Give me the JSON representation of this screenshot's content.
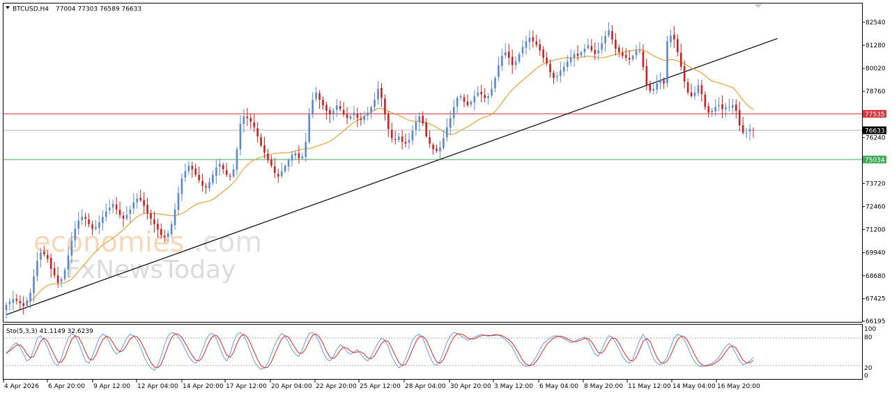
{
  "header": {
    "symbol": "BTCUSD,H4",
    "ohlc": "77004 77303 76589 76633"
  },
  "indicator": {
    "label": "Sto(5,3,3) 41.1149 32.6239",
    "levels": [
      "100",
      "80",
      "20",
      "0"
    ]
  },
  "watermark": {
    "line1_a": "economies",
    "line1_b": ".com",
    "line2": "FxNewsToday"
  },
  "price_labels": {
    "current": "76633",
    "resistance": "77535",
    "support": "75034"
  },
  "colors": {
    "bull": "#5b87d1",
    "bear": "#cc1f1f",
    "ma": "#e4a23c",
    "resistance": "#d9333f",
    "support": "#3fa95b",
    "stoch_main": "#6b9bd8",
    "stoch_signal": "#cc2a2a",
    "current_label_bg": "#000000"
  },
  "chart_data": {
    "type": "candlestick",
    "y_ticks": [
      "82540",
      "81280",
      "80020",
      "78760",
      "77500",
      "76240",
      "74980",
      "73720",
      "72460",
      "71200",
      "69940",
      "68680",
      "67425",
      "66195"
    ],
    "x_ticks": [
      "4 Apr 2026",
      "6 Apr 20:00",
      "9 Apr 12:00",
      "12 Apr 04:00",
      "14 Apr 20:00",
      "17 Apr 12:00",
      "20 Apr 04:00",
      "22 Apr 20:00",
      "25 Apr 12:00",
      "28 Apr 04:00",
      "30 Apr 20:00",
      "3 May 12:00",
      "6 May 04:00",
      "8 May 20:00",
      "11 May 12:00",
      "14 May 04:00",
      "16 May 20:00"
    ],
    "ylim": [
      66195,
      83600
    ],
    "resistance": 77535,
    "support": 75034,
    "current": 76633,
    "trendline": [
      [
        0,
        66550
      ],
      [
        224,
        81650
      ]
    ],
    "closes": [
      67080,
      67250,
      67400,
      67310,
      67180,
      67030,
      67320,
      67750,
      68650,
      69500,
      69950,
      69850,
      69600,
      69050,
      68700,
      68300,
      68500,
      69000,
      69800,
      70600,
      71250,
      71700,
      71900,
      71800,
      71500,
      71250,
      71350,
      71600,
      71900,
      72200,
      72400,
      72600,
      72300,
      72000,
      71800,
      72000,
      72300,
      72700,
      72900,
      72800,
      72500,
      72100,
      71800,
      71500,
      71200,
      70900,
      70800,
      71000,
      71500,
      72300,
      73200,
      74000,
      74400,
      74700,
      74500,
      74200,
      73900,
      73600,
      73500,
      73800,
      74200,
      74600,
      74800,
      74500,
      74200,
      74100,
      74500,
      75600,
      77000,
      77400,
      77300,
      77100,
      76800,
      76300,
      75800,
      75400,
      75000,
      74700,
      74300,
      74100,
      74400,
      74700,
      75000,
      75300,
      75400,
      75100,
      75200,
      76000,
      77500,
      78300,
      78700,
      78300,
      78000,
      77700,
      77500,
      77700,
      78000,
      77800,
      77500,
      77300,
      77400,
      77600,
      77300,
      77200,
      77400,
      77600,
      77900,
      78300,
      78900,
      78400,
      77500,
      76700,
      76200,
      76100,
      76300,
      76000,
      75900,
      76100,
      76600,
      77100,
      77400,
      77000,
      76300,
      75900,
      75600,
      75500,
      75700,
      76200,
      76800,
      77300,
      77900,
      78400,
      78500,
      78200,
      78000,
      78200,
      78500,
      78700,
      78600,
      78400,
      78500,
      78900,
      79500,
      80200,
      80700,
      80900,
      80600,
      80200,
      80400,
      80800,
      81200,
      81500,
      81700,
      81500,
      81300,
      81000,
      80600,
      80300,
      79800,
      79500,
      79600,
      79900,
      80100,
      80400,
      80600,
      80800,
      80700,
      80900,
      81100,
      81300,
      81000,
      80800,
      81000,
      81400,
      81800,
      82100,
      81600,
      81100,
      80900,
      80700,
      80600,
      80500,
      80700,
      81000,
      81000,
      80100,
      79100,
      78800,
      78900,
      79200,
      79400,
      79200,
      81500,
      81800,
      81600,
      80900,
      80100,
      79300,
      78700,
      78500,
      78700,
      79100,
      78600,
      77900,
      77600,
      77700,
      77900,
      78000,
      77800,
      77900,
      77900,
      78000,
      77700,
      76900,
      76500,
      76500,
      76700,
      76633
    ],
    "stochastic_main": [
      45,
      55,
      65,
      70,
      60,
      45,
      30,
      35,
      55,
      80,
      85,
      75,
      60,
      40,
      25,
      20,
      35,
      60,
      80,
      90,
      85,
      70,
      50,
      30,
      25,
      40,
      60,
      80,
      88,
      85,
      70,
      55,
      45,
      50,
      65,
      80,
      88,
      85,
      75,
      60,
      40,
      25,
      15,
      10,
      20,
      40,
      65,
      85,
      92,
      90,
      82,
      70,
      55,
      40,
      30,
      25,
      35,
      55,
      75,
      88,
      90,
      80,
      60,
      40,
      30,
      45,
      70,
      88,
      92,
      85,
      70,
      50,
      30,
      18,
      12,
      15,
      25,
      45,
      65,
      80,
      90,
      85,
      70,
      55,
      45,
      40,
      55,
      75,
      90,
      92,
      85,
      70,
      50,
      35,
      30,
      40,
      55,
      65,
      60,
      50,
      45,
      50,
      55,
      45,
      35,
      30,
      40,
      55,
      70,
      80,
      75,
      60,
      40,
      25,
      15,
      20,
      35,
      55,
      75,
      85,
      88,
      80,
      60,
      40,
      25,
      20,
      30,
      50,
      70,
      85,
      92,
      90,
      85,
      80,
      75,
      78,
      82,
      85,
      88,
      86,
      84,
      86,
      88,
      86,
      82,
      76,
      70,
      60,
      45,
      30,
      22,
      18,
      20,
      28,
      40,
      55,
      68,
      75,
      80,
      84,
      85,
      82,
      78,
      74,
      70,
      72,
      76,
      80,
      82,
      75,
      60,
      45,
      40,
      55,
      72,
      85,
      82,
      70,
      55,
      40,
      30,
      25,
      35,
      55,
      75,
      88,
      75,
      55,
      35,
      25,
      22,
      28,
      40,
      60,
      80,
      88,
      85,
      75,
      60,
      42,
      28,
      20,
      18,
      20,
      22,
      25,
      30,
      38,
      50,
      62,
      68,
      60,
      45,
      30,
      22,
      25,
      30,
      38
    ],
    "stochastic_signal": [
      48,
      52,
      58,
      65,
      65,
      58,
      45,
      37,
      40,
      57,
      73,
      80,
      73,
      58,
      42,
      28,
      27,
      38,
      58,
      77,
      85,
      82,
      68,
      50,
      35,
      32,
      42,
      60,
      76,
      84,
      81,
      70,
      57,
      50,
      53,
      65,
      78,
      84,
      83,
      73,
      58,
      42,
      27,
      17,
      15,
      23,
      42,
      63,
      81,
      89,
      88,
      81,
      69,
      55,
      42,
      32,
      30,
      38,
      55,
      73,
      84,
      86,
      77,
      60,
      43,
      38,
      48,
      68,
      83,
      88,
      82,
      68,
      50,
      33,
      20,
      15,
      17,
      28,
      45,
      63,
      78,
      85,
      82,
      70,
      57,
      47,
      47,
      57,
      73,
      86,
      89,
      82,
      68,
      52,
      38,
      35,
      42,
      53,
      60,
      58,
      52,
      48,
      50,
      50,
      45,
      37,
      35,
      42,
      55,
      68,
      75,
      72,
      58,
      42,
      27,
      20,
      23,
      37,
      55,
      72,
      83,
      84,
      76,
      60,
      42,
      28,
      25,
      33,
      50,
      68,
      82,
      89,
      89,
      86,
      80,
      78,
      78,
      82,
      85,
      86,
      86,
      85,
      86,
      87,
      85,
      81,
      76,
      69,
      58,
      45,
      32,
      23,
      20,
      22,
      29,
      41,
      54,
      66,
      74,
      80,
      83,
      84,
      82,
      78,
      74,
      72,
      73,
      76,
      79,
      79,
      72,
      60,
      48,
      47,
      56,
      71,
      80,
      79,
      69,
      55,
      42,
      32,
      30,
      38,
      55,
      73,
      79,
      73,
      55,
      38,
      27,
      25,
      30,
      43,
      60,
      76,
      84,
      83,
      73,
      59,
      43,
      30,
      22,
      19,
      20,
      22,
      26,
      31,
      39,
      50,
      60,
      63,
      58,
      45,
      32,
      26,
      26,
      31
    ]
  }
}
